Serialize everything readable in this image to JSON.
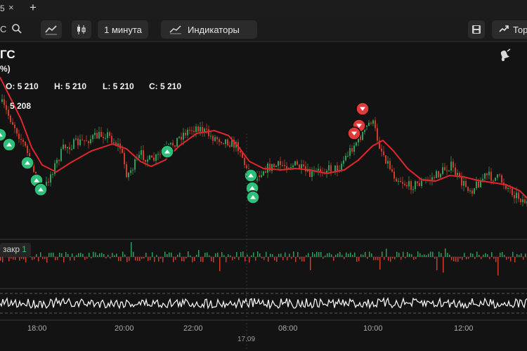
{
  "tab": {
    "title": "5",
    "close": "×",
    "add": "+"
  },
  "toolbar": {
    "ticker_fragment": "C",
    "interval": "1 минута",
    "indicators": "Индикаторы",
    "trade": "Тор"
  },
  "symbol": {
    "name": "ГС",
    "change": "%)"
  },
  "ohlc": {
    "o": "O: 5 210",
    "h": "H: 5 210",
    "l": "L: 5 210",
    "c": "C: 5 210"
  },
  "moving_average": {
    "value": "5 208",
    "color": "#e0262c"
  },
  "volume_legend": {
    "label": "закр",
    "value": "1"
  },
  "time_axis": {
    "labels": [
      "18:00",
      "20:00",
      "22:00",
      "08:00",
      "10:00",
      "12:00"
    ],
    "date": "17.09"
  },
  "colors": {
    "up": "#2e9e58",
    "down": "#cf3b2c",
    "buy_marker": "#2ec07a",
    "sell_marker": "#e03a3a",
    "background": "#131313"
  },
  "icons": [
    "search-icon",
    "drawing-tools-icon",
    "candles-icon",
    "indicators-icon",
    "save-icon",
    "trade-icon",
    "alert-bell-icon",
    "buy-arrow-icon",
    "sell-arrow-icon"
  ]
}
